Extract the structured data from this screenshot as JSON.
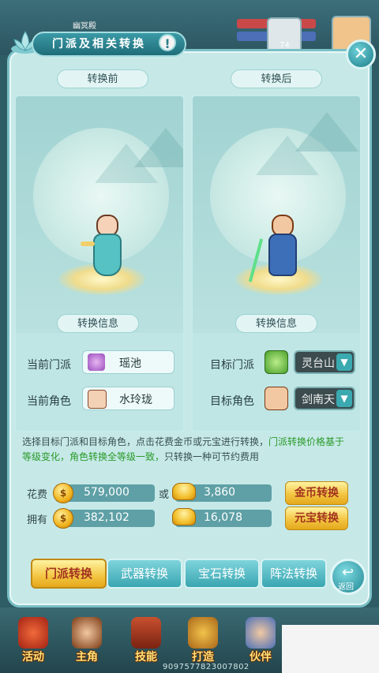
{
  "hud": {
    "name": "幽冥殿",
    "level_num": "74"
  },
  "window": {
    "title": "门派及相关转换",
    "alert_icon": "!",
    "close_icon": "close-x"
  },
  "before": {
    "header": "转换前",
    "info_header": "转换信息",
    "sect_label": "当前门派",
    "sect_value": "瑶池",
    "role_label": "当前角色",
    "role_value": "水玲珑"
  },
  "after": {
    "header": "转换后",
    "info_header": "转换信息",
    "sect_label": "目标门派",
    "sect_value": "灵台山",
    "role_label": "目标角色",
    "role_value": "剑南天"
  },
  "notice": {
    "part1": "选择目标门派和目标角色，点击花费金币或元宝进行转换，",
    "part2": "门派转换价格基于等级变化，角色转换全等级一致，",
    "part3": "只转换一种可节约费用"
  },
  "cost": {
    "cost_label": "花费",
    "own_label": "拥有",
    "or_label": "或",
    "gold_cost": "579,000",
    "gold_own": "382,102",
    "ingot_cost": "3,860",
    "ingot_own": "16,078",
    "gold_button": "金币转换",
    "ingot_button": "元宝转换"
  },
  "tabs": [
    {
      "label": "门派转换",
      "active": true
    },
    {
      "label": "武器转换",
      "active": false
    },
    {
      "label": "宝石转换",
      "active": false
    },
    {
      "label": "阵法转换",
      "active": false
    }
  ],
  "back_label": "返回",
  "bottom_nav": [
    {
      "label": "活动",
      "icon": "activity-icon"
    },
    {
      "label": "主角",
      "icon": "hero-icon"
    },
    {
      "label": "技能",
      "icon": "skill-book-icon"
    },
    {
      "label": "打造",
      "icon": "forge-icon"
    },
    {
      "label": "伙伴",
      "icon": "partner-icon"
    }
  ],
  "build_number": "9097577823007802",
  "colors": {
    "panel_bg": "#c6e9e8",
    "accent_teal": "#3aa6b1",
    "highlight_green": "#2a9a28",
    "gold_button": "#f3c542"
  }
}
